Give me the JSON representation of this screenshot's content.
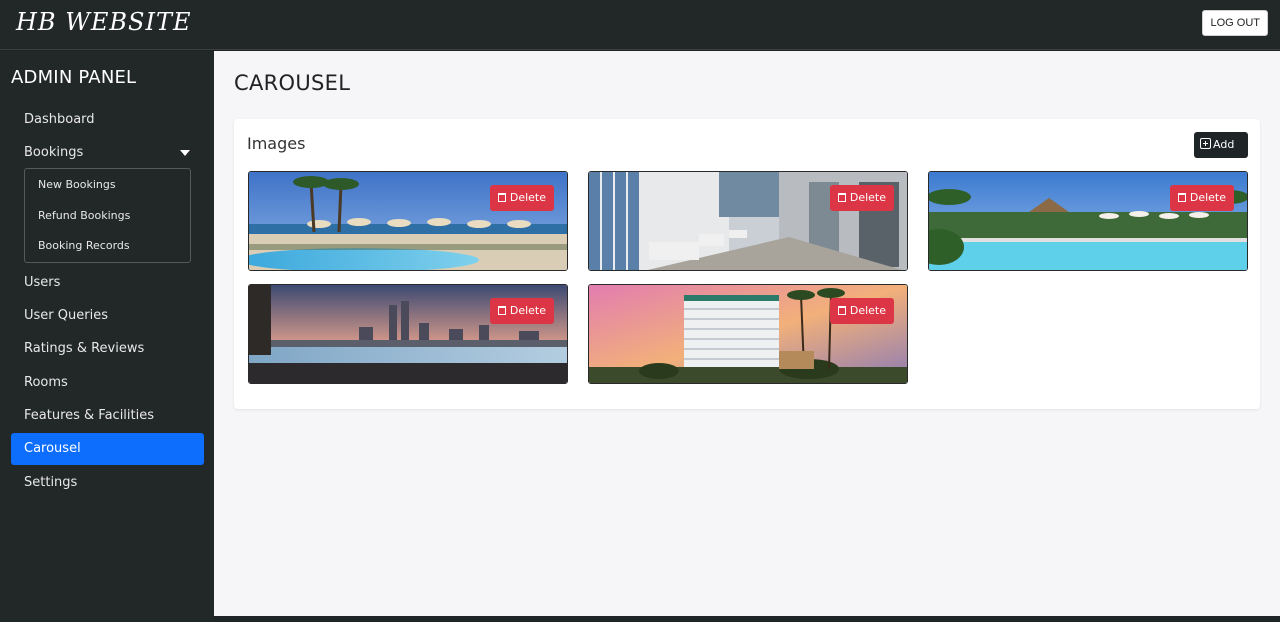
{
  "header": {
    "brand": "HB WEBSITE",
    "logout_label": "LOG OUT"
  },
  "sidebar": {
    "title": "ADMIN PANEL",
    "items": [
      {
        "label": "Dashboard"
      },
      {
        "label": "Bookings"
      },
      {
        "label": "Users"
      },
      {
        "label": "User Queries"
      },
      {
        "label": "Ratings & Reviews"
      },
      {
        "label": "Rooms"
      },
      {
        "label": "Features & Facilities"
      },
      {
        "label": "Carousel",
        "active": true
      },
      {
        "label": "Settings"
      }
    ],
    "bookings_submenu": [
      "New Bookings",
      "Refund Bookings",
      "Booking Records"
    ]
  },
  "main": {
    "title": "CAROUSEL",
    "card_title": "Images",
    "add_label": "Add",
    "delete_label": "Delete",
    "images": [
      {
        "name": "beach-resort-pool"
      },
      {
        "name": "hotel-lobby-interior"
      },
      {
        "name": "tropical-pool-garden"
      },
      {
        "name": "city-skyline-infinity-pool"
      },
      {
        "name": "highrise-hotel-sunset"
      }
    ]
  },
  "colors": {
    "accent": "#0d6efd",
    "danger": "#dc3545",
    "dark": "#222728"
  }
}
